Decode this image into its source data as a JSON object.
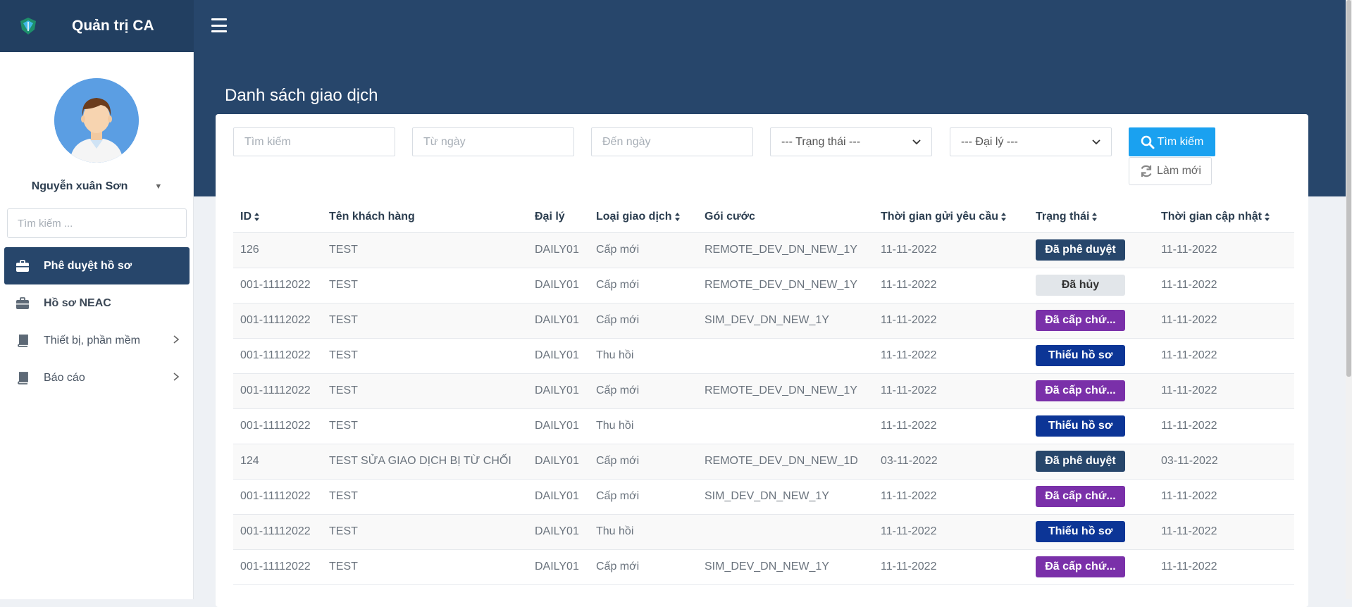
{
  "app": {
    "brand_title": "Quản trị CA"
  },
  "sidebar": {
    "user_name": "Nguyễn xuân Sơn",
    "search_placeholder": "Tìm kiếm ...",
    "items": [
      {
        "label": "Phê duyệt hồ sơ",
        "icon": "briefcase-icon"
      },
      {
        "label": "Hồ sơ NEAC",
        "icon": "briefcase-icon"
      },
      {
        "label": "Thiết bị, phần mềm",
        "icon": "book-icon"
      },
      {
        "label": "Báo cáo",
        "icon": "book-icon"
      }
    ]
  },
  "page": {
    "title": "Danh sách giao dịch"
  },
  "filters": {
    "keyword_placeholder": "Tìm kiếm",
    "from_date_placeholder": "Từ ngày",
    "to_date_placeholder": "Đến ngày",
    "status_select": "--- Trạng thái ---",
    "agent_select": "--- Đại lý ---",
    "search_button": "Tìm kiếm",
    "refresh_button": "Làm mới"
  },
  "table": {
    "headers": [
      "ID",
      "Tên khách hàng",
      "Đại lý",
      "Loại giao dịch",
      "Gói cước",
      "Thời gian gửi yêu cầu",
      "Trạng thái",
      "Thời gian cập nhật"
    ],
    "rows": [
      {
        "id": "126",
        "customer": "TEST",
        "agent": "DAILY01",
        "type": "Cấp mới",
        "package": "REMOTE_DEV_DN_NEW_1Y",
        "sent": "11-11-2022",
        "status": "Đã phê duyệt",
        "updated": "11-11-2022"
      },
      {
        "id": "001-11112022",
        "customer": "TEST",
        "agent": "DAILY01",
        "type": "Cấp mới",
        "package": "REMOTE_DEV_DN_NEW_1Y",
        "sent": "11-11-2022",
        "status": "Đã hủy",
        "updated": "11-11-2022"
      },
      {
        "id": "001-11112022",
        "customer": "TEST",
        "agent": "DAILY01",
        "type": "Cấp mới",
        "package": "SIM_DEV_DN_NEW_1Y",
        "sent": "11-11-2022",
        "status": "Đã cấp chứ...",
        "updated": "11-11-2022"
      },
      {
        "id": "001-11112022",
        "customer": "TEST",
        "agent": "DAILY01",
        "type": "Thu hồi",
        "package": "",
        "sent": "11-11-2022",
        "status": "Thiếu hồ sơ",
        "updated": "11-11-2022"
      },
      {
        "id": "001-11112022",
        "customer": "TEST",
        "agent": "DAILY01",
        "type": "Cấp mới",
        "package": "REMOTE_DEV_DN_NEW_1Y",
        "sent": "11-11-2022",
        "status": "Đã cấp chứ...",
        "updated": "11-11-2022"
      },
      {
        "id": "001-11112022",
        "customer": "TEST",
        "agent": "DAILY01",
        "type": "Thu hồi",
        "package": "",
        "sent": "11-11-2022",
        "status": "Thiếu hồ sơ",
        "updated": "11-11-2022"
      },
      {
        "id": "124",
        "customer": "TEST SỬA GIAO DỊCH BỊ TỪ CHỐI",
        "agent": "DAILY01",
        "type": "Cấp mới",
        "package": "REMOTE_DEV_DN_NEW_1D",
        "sent": "03-11-2022",
        "status": "Đã phê duyệt",
        "updated": "03-11-2022"
      },
      {
        "id": "001-11112022",
        "customer": "TEST",
        "agent": "DAILY01",
        "type": "Cấp mới",
        "package": "SIM_DEV_DN_NEW_1Y",
        "sent": "11-11-2022",
        "status": "Đã cấp chứ...",
        "updated": "11-11-2022"
      },
      {
        "id": "001-11112022",
        "customer": "TEST",
        "agent": "DAILY01",
        "type": "Thu hồi",
        "package": "",
        "sent": "11-11-2022",
        "status": "Thiếu hồ sơ",
        "updated": "11-11-2022"
      },
      {
        "id": "001-11112022",
        "customer": "TEST",
        "agent": "DAILY01",
        "type": "Cấp mới",
        "package": "SIM_DEV_DN_NEW_1Y",
        "sent": "11-11-2022",
        "status": "Đã cấp chứ...",
        "updated": "11-11-2022"
      }
    ]
  },
  "status_colors": {
    "Đã phê duyệt": {
      "bg": "#27466b",
      "fg": "#ffffff"
    },
    "Đã hủy": {
      "bg": "#e2e6ea",
      "fg": "#333333"
    },
    "Đã cấp chứ...": {
      "bg": "#7a30a9",
      "fg": "#ffffff"
    },
    "Thiếu hồ sơ": {
      "bg": "#0c3596",
      "fg": "#ffffff"
    }
  },
  "colors": {
    "header_bg": "#27466b",
    "primary_button": "#1aa1f0"
  }
}
